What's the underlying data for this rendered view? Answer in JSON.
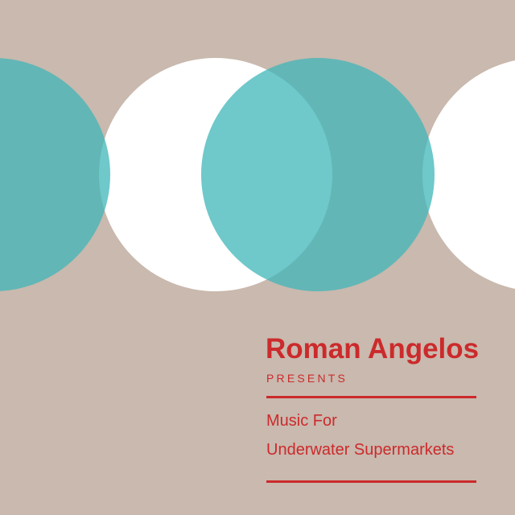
{
  "cover": {
    "artist": "Roman Angelos",
    "presents": "PRESENTS",
    "title_line_1": "Music For",
    "title_line_2": "Underwater Supermarkets"
  },
  "colors": {
    "background": "#c9b9ae",
    "teal": "#3fb5b8",
    "white": "#ffffff",
    "text_red": "#cc2a2c"
  }
}
